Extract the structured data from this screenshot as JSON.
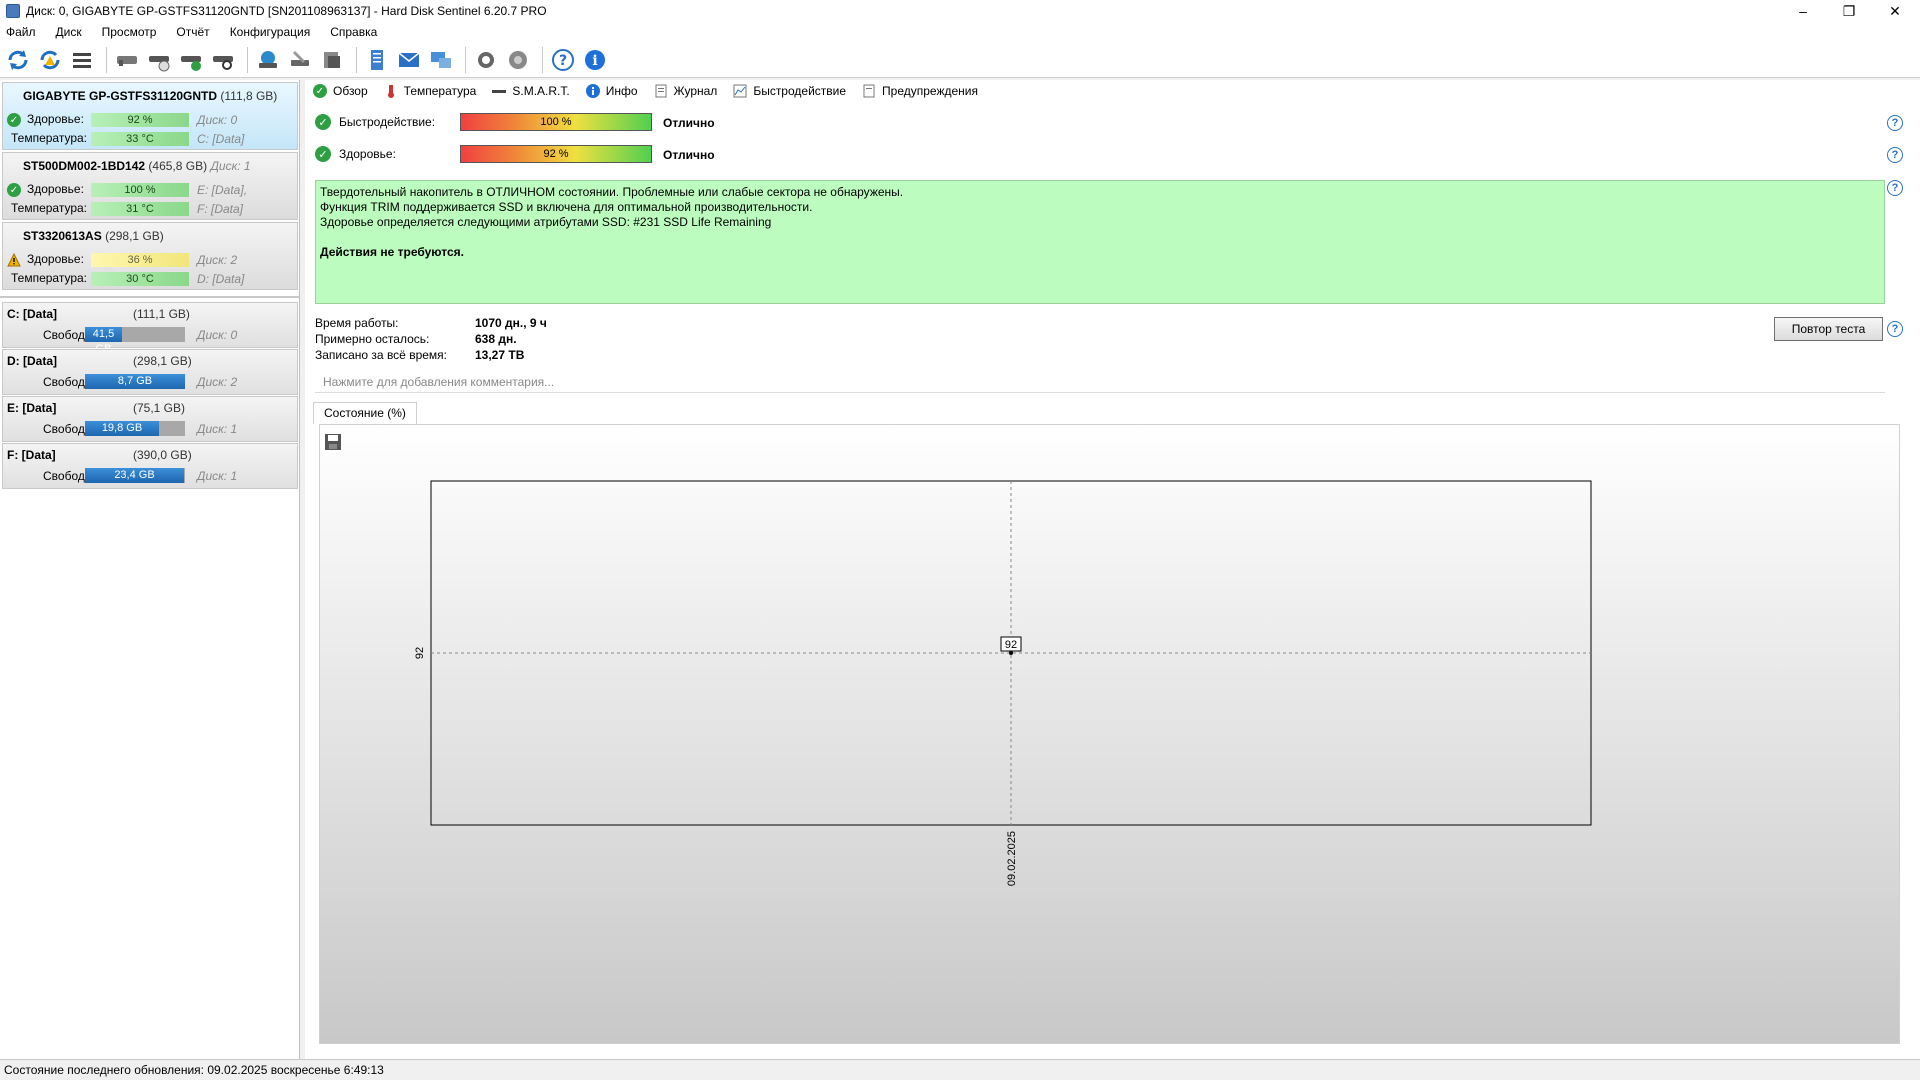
{
  "window": {
    "title": "Диск: 0, GIGABYTE GP-GSTFS31120GNTD [SN201108963137]  -  Hard Disk Sentinel 6.20.7 PRO",
    "controls": [
      "–",
      "❐",
      "✕"
    ]
  },
  "menu": [
    "Файл",
    "Диск",
    "Просмотр",
    "Отчёт",
    "Конфигурация",
    "Справка"
  ],
  "toolbar": {
    "icons": [
      "refresh-icon",
      "refresh-warning-icon",
      "list-icon",
      "disk-icon",
      "disk-clock-icon",
      "disk-check-icon",
      "disk-search-icon",
      "drive-globe-icon",
      "drive-tools-icon",
      "drive-stack-icon",
      "report-icon",
      "mail-icon",
      "network-icon",
      "settings-icon",
      "sound-icon",
      "help-icon",
      "info-icon"
    ]
  },
  "disks": [
    {
      "name": "GIGABYTE GP-GSTFS31120GNTD",
      "size": "(111,8 GB)",
      "disk_label": "",
      "health_label": "Здоровье:",
      "health": "92 %",
      "health_value": 92,
      "health_extra": "Диск: 0",
      "temp_label": "Температура:",
      "temp": "33 °C",
      "temp_extra": "C: [Data]",
      "status": "ok"
    },
    {
      "name": "ST500DM002-1BD142",
      "size": "(465,8 GB)",
      "disk_label": "Диск: 1",
      "health_label": "Здоровье:",
      "health": "100 %",
      "health_value": 100,
      "health_extra": "E: [Data],",
      "temp_label": "Температура:",
      "temp": "31 °C",
      "temp_extra": "F: [Data]",
      "status": "ok"
    },
    {
      "name": "ST3320613AS",
      "size": "(298,1 GB)",
      "disk_label": "",
      "health_label": "Здоровье:",
      "health": "36 %",
      "health_value": 36,
      "health_extra": "Диск: 2",
      "temp_label": "Температура:",
      "temp": "30 °C",
      "temp_extra": "D: [Data]",
      "status": "warning"
    }
  ],
  "volumes": [
    {
      "name": "C: [Data]",
      "size": "(111,1 GB)",
      "free_label": "Свободно",
      "free": "41,5 GB",
      "free_fraction": 0.37,
      "disk": "Диск: 0"
    },
    {
      "name": "D: [Data]",
      "size": "(298,1 GB)",
      "free_label": "Свободно",
      "free": "8,7 GB",
      "free_fraction": 1.0,
      "disk": "Диск: 2"
    },
    {
      "name": "E: [Data]",
      "size": "(75,1 GB)",
      "free_label": "Свободно",
      "free": "19,8 GB",
      "free_fraction": 0.74,
      "disk": "Диск: 1"
    },
    {
      "name": "F: [Data]",
      "size": "(390,0 GB)",
      "free_label": "Свободно",
      "free": "23,4 GB",
      "free_fraction": 0.99,
      "disk": "Диск: 1"
    }
  ],
  "tabs": [
    {
      "label": "Обзор",
      "icon": "check-icon"
    },
    {
      "label": "Температура",
      "icon": "thermometer-icon"
    },
    {
      "label": "S.M.A.R.T.",
      "icon": "smart-icon"
    },
    {
      "label": "Инфо",
      "icon": "info-icon"
    },
    {
      "label": "Журнал",
      "icon": "log-icon"
    },
    {
      "label": "Быстродействие",
      "icon": "performance-icon"
    },
    {
      "label": "Предупреждения",
      "icon": "warnings-icon"
    }
  ],
  "overview": {
    "performance_label": "Быстродействие:",
    "performance": "100 %",
    "performance_rating": "Отлично",
    "health_label": "Здоровье:",
    "health": "92 %",
    "health_rating": "Отлично",
    "note_lines": [
      "Твердотельный накопитель в ОТЛИЧНОМ состоянии. Проблемные или слабые сектора не обнаружены.",
      "Функция TRIM поддерживается SSD и включена для оптимальной производительности.",
      "Здоровье определяется следующими атрибутами SSD: #231 SSD Life Remaining"
    ],
    "note_action": "Действия не требуются.",
    "uptime_label": "Время работы:",
    "uptime": "1070 дн., 9 ч",
    "remaining_label": "Примерно осталось:",
    "remaining": "638 дн.",
    "written_label": "Записано за всё время:",
    "written": "13,27 TB",
    "retest_button": "Повтор теста",
    "comment_placeholder": "Нажмите для добавления комментария...",
    "chart_tab": "Состояние (%)"
  },
  "chart_data": {
    "type": "line",
    "x": [
      "09.02.2025"
    ],
    "series": [
      {
        "values": [
          92
        ]
      }
    ],
    "ytick_labels": [
      "92"
    ],
    "xtick_labels": [
      "09.02.2025"
    ],
    "data_labels": [
      "92"
    ],
    "title": "",
    "xlabel": "",
    "ylabel": ""
  },
  "status_bar": "Состояние последнего обновления: 09.02.2025 воскресенье 6:49:13"
}
